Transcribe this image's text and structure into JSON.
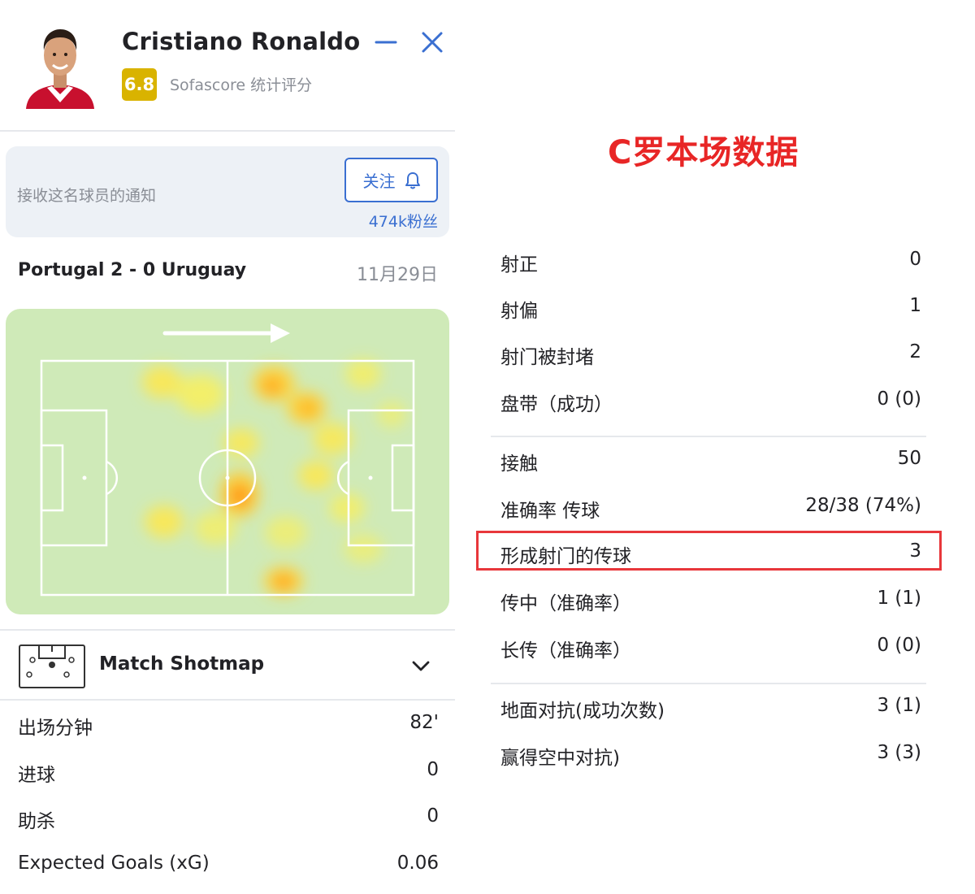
{
  "header": {
    "player_name": "Cristiano Ronaldo",
    "rating": "6.8",
    "rating_label": "Sofascore 统计评分",
    "colors": {
      "rating_badge": "#d9b300",
      "accent": "#3a6fd1"
    },
    "icons": {
      "minimize": "minimize-icon",
      "close": "close-icon"
    }
  },
  "follow": {
    "text": "接收这名球员的通知",
    "button_label": "关注",
    "followers": "474k粉丝",
    "icon": "bell-icon"
  },
  "match": {
    "title": "Portugal 2 - 0 Uruguay",
    "date": "11月29日"
  },
  "shotmap": {
    "label": "Match Shotmap",
    "icon": "pitch-icon",
    "expand_icon": "chevron-down-icon"
  },
  "left_stats": [
    {
      "label": "出场分钟",
      "value": "82'"
    },
    {
      "label": "进球",
      "value": "0"
    },
    {
      "label": "助杀",
      "value": "0"
    },
    {
      "label": "Expected Goals (xG)",
      "value": "0.06"
    }
  ],
  "caption": "C罗本场数据",
  "right_stats": {
    "group1": [
      {
        "label": "射正",
        "value": "0"
      },
      {
        "label": "射偏",
        "value": "1"
      },
      {
        "label": "射门被封堵",
        "value": "2"
      },
      {
        "label": "盘带（成功）",
        "value": "0 (0)"
      }
    ],
    "group2": [
      {
        "label": "接触",
        "value": "50"
      },
      {
        "label": "准确率 传球",
        "value": "28/38 (74%)"
      },
      {
        "label": "形成射门的传球",
        "value": "3",
        "highlighted": true
      },
      {
        "label": "传中（准确率）",
        "value": "1 (1)"
      },
      {
        "label": "长传（准确率）",
        "value": "0 (0)"
      }
    ],
    "group3": [
      {
        "label": "地面对抗(成功次数)",
        "value": "3 (1)"
      },
      {
        "label": "赢得空中对抗)",
        "value": "3 (3)"
      }
    ]
  },
  "colors": {
    "highlight_border": "#e8373b",
    "caption": "#e82626",
    "pitch": "#cfeab8"
  }
}
